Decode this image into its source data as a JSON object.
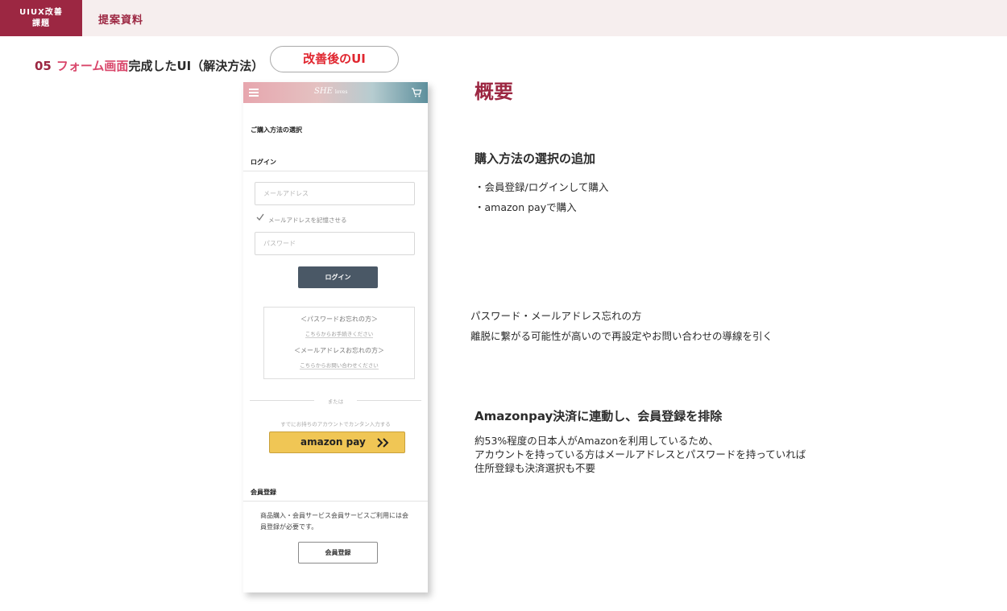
{
  "header": {
    "badge_line1": "UIUX改善",
    "badge_line2": "課題",
    "title": "提案資料"
  },
  "section": {
    "number": "05",
    "title_highlight": "フォーム画面",
    "title_rest": "完成したUI（解決方法）",
    "after_label": "改善後のUI"
  },
  "phone": {
    "logo": "SHE",
    "logo_sub": "loves",
    "purchase_method": "ご購入方法の選択",
    "login_heading": "ログイン",
    "email_placeholder": "メールアドレス",
    "remember_label": "メールアドレスを記憶させる",
    "password_placeholder": "パスワード",
    "login_button": "ログイン",
    "forgot_password_heading": "＜パスワードお忘れの方＞",
    "forgot_password_link": "こちらからお手続きください",
    "forgot_email_heading": "＜メールアドレスお忘れの方＞",
    "forgot_email_link": "こちらからお問い合わせください",
    "or_text": "または",
    "account_hint": "すでにお持ちのアカウントでカンタン入力する",
    "amazon_pay_label": "amazon pay",
    "member_heading": "会員登録",
    "member_desc": "商品購入・会員サービス会員サービスご利用には会員登録が必要です。",
    "member_button": "会員登録"
  },
  "overview": {
    "title": "概要",
    "heading1": "購入方法の選択の追加",
    "bullet1": "・会員登録/ログインして購入",
    "bullet2": "・amazon payで購入",
    "forgot_title": "パスワード・メールアドレス忘れの方",
    "forgot_desc": "離脱に繋がる可能性が高いので再設定やお問い合わせの導線を引く",
    "heading2": "Amazonpay決済に連動し、会員登録を排除",
    "line1": "約53%程度の日本人がAmazonを利用しているため、",
    "line2": "アカウントを持っている方はメールアドレスとパスワードを持っていれば",
    "line3": "住所登録も決済選択も不要"
  },
  "colors": {
    "brand": "#9c2742",
    "highlight": "#d9476b",
    "after_label": "#e0262f",
    "login_button": "#4a5866",
    "amazon_pay": "#f0c655"
  }
}
